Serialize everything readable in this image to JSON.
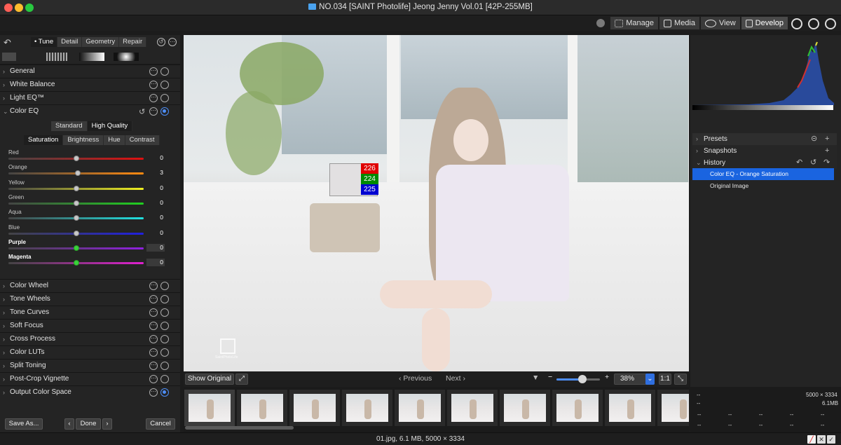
{
  "window": {
    "title": "NO.034 [SAINT Photolife] Jeong Jenny Vol.01 [42P-255MB]"
  },
  "modes": {
    "manage": "Manage",
    "media": "Media",
    "view": "View",
    "develop": "Develop"
  },
  "left_panel": {
    "tabs": [
      "Tune",
      "Detail",
      "Geometry",
      "Repair"
    ],
    "active_tab": "Tune",
    "sections_top": [
      "General",
      "White Balance",
      "Light EQ™"
    ],
    "color_eq": {
      "title": "Color EQ",
      "quality_modes": [
        "Standard",
        "High Quality"
      ],
      "active_quality": "High Quality",
      "adjust_tabs": [
        "Saturation",
        "Brightness",
        "Hue",
        "Contrast"
      ],
      "active_adjust": "Saturation",
      "sliders": [
        {
          "label": "Red",
          "value": "0",
          "position": 0.5
        },
        {
          "label": "Orange",
          "value": "3",
          "position": 0.515
        },
        {
          "label": "Yellow",
          "value": "0",
          "position": 0.5
        },
        {
          "label": "Green",
          "value": "0",
          "position": 0.5
        },
        {
          "label": "Aqua",
          "value": "0",
          "position": 0.5
        },
        {
          "label": "Blue",
          "value": "0",
          "position": 0.5
        },
        {
          "label": "Purple",
          "value": "0",
          "position": 0.5
        },
        {
          "label": "Magenta",
          "value": "0",
          "position": 0.5
        }
      ]
    },
    "sections_bottom": [
      "Color Wheel",
      "Tone Wheels",
      "Tone Curves",
      "Soft Focus",
      "Cross Process",
      "Color LUTs",
      "Split Toning",
      "Post-Crop Vignette",
      "Output Color Space"
    ],
    "buttons": {
      "save_as": "Save As...",
      "done": "Done",
      "cancel": "Cancel"
    }
  },
  "viewer": {
    "pixel_readout": {
      "r": "226",
      "g": "224",
      "b": "225"
    },
    "watermark": "SaintPhotoLife"
  },
  "viewer_controls": {
    "show_original": "Show Original",
    "previous": "Previous",
    "next": "Next",
    "zoom_percent": "38%",
    "zoom_level": 0.38,
    "one_to_one": "1:1"
  },
  "right_panel": {
    "presets": "Presets",
    "snapshots": "Snapshots",
    "history": "History",
    "history_items": [
      "Color EQ - Orange Saturation",
      "Original Image"
    ],
    "info": {
      "dimensions": "5000 × 3334",
      "size": "6.1MB",
      "placeholder": "--"
    }
  },
  "status_bar": {
    "text": "01.jpg, 6.1 MB, 5000 × 3334"
  }
}
